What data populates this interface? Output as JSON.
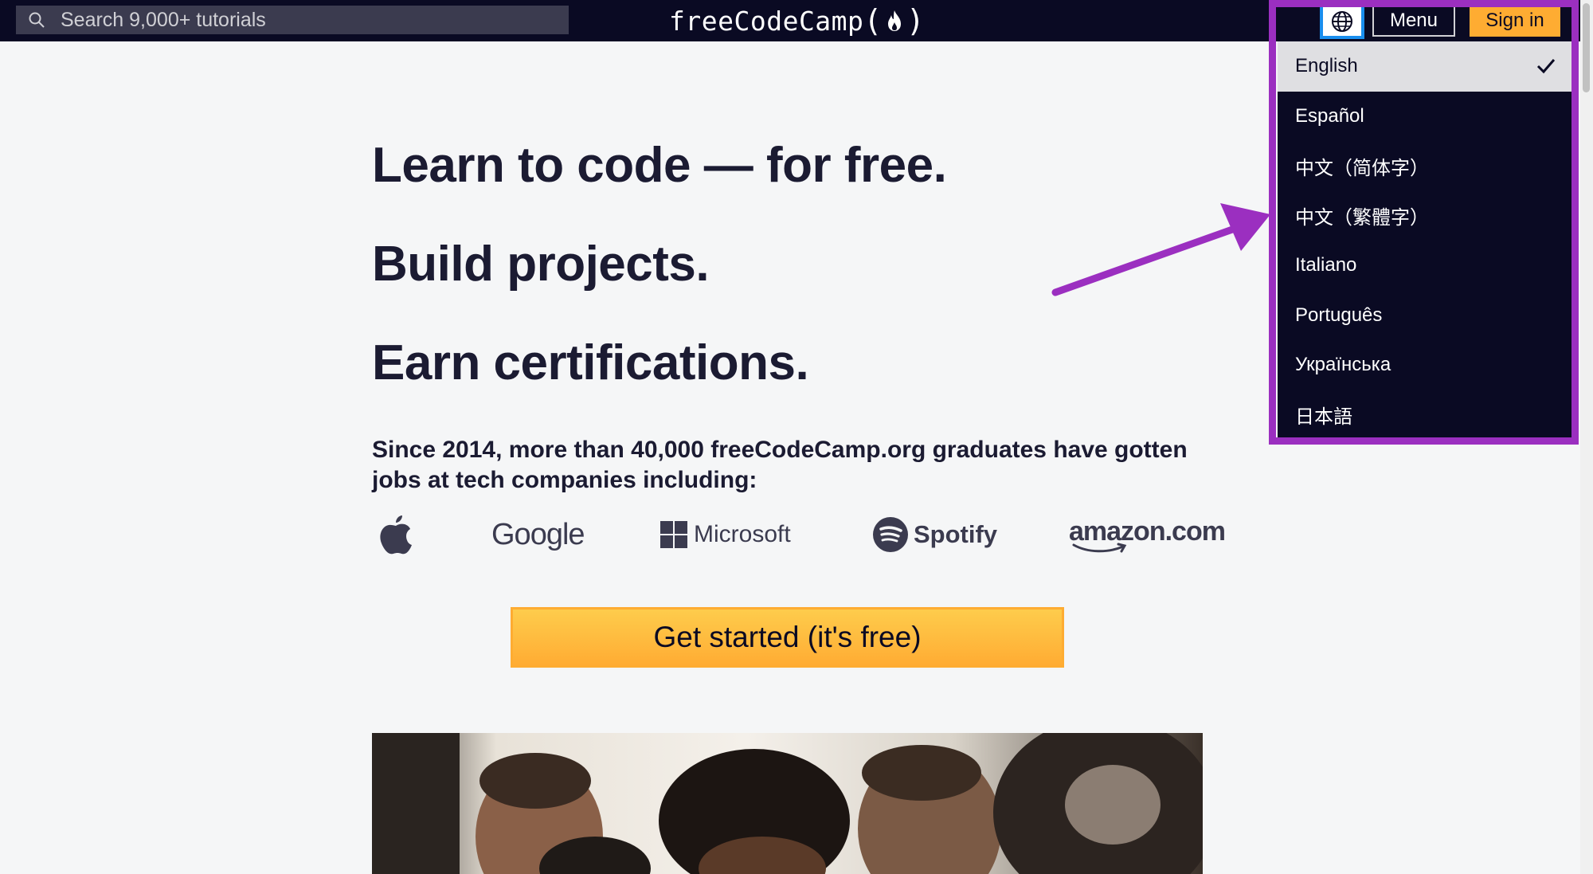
{
  "search": {
    "placeholder": "Search 9,000+ tutorials"
  },
  "brand": {
    "name": "freeCodeCamp",
    "open_paren": "(",
    "close_paren": ")"
  },
  "nav": {
    "menu_label": "Menu",
    "signin_label": "Sign in",
    "language_icon": "globe-icon"
  },
  "language_menu": {
    "items": [
      "English",
      "Español",
      "中文（简体字）",
      "中文（繁體字）",
      "Italiano",
      "Português",
      "Українська",
      "日本語"
    ],
    "selected": "English"
  },
  "hero": {
    "headline_1": "Learn to code — for free.",
    "headline_2": "Build projects.",
    "headline_3": "Earn certifications.",
    "subtext": "Since 2014, more than 40,000 freeCodeCamp.org graduates have gotten jobs at tech companies including:"
  },
  "companies": {
    "google": "Google",
    "microsoft": "Microsoft",
    "spotify": "Spotify",
    "amazon": "amazon.com"
  },
  "cta": {
    "label": "Get started (it's free)"
  },
  "colors": {
    "nav_bg": "#0a0a23",
    "accent_yellow": "#feac32",
    "annotation_purple": "#9b2fc0",
    "focus_blue": "#198eee",
    "text_dark": "#1b1b32"
  }
}
